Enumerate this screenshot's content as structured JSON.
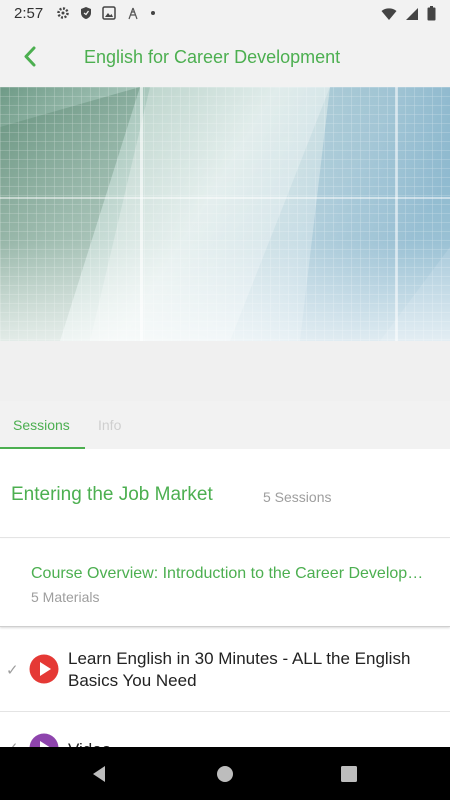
{
  "status_bar": {
    "time": "2:57",
    "icons": [
      "gear-icon",
      "shield-icon",
      "image-icon",
      "tower-icon",
      "dot-icon",
      "wifi-icon",
      "cell-signal-icon",
      "battery-icon"
    ]
  },
  "app_bar": {
    "back_icon": "chevron-left-icon",
    "title": "English for Career Development"
  },
  "tabs": [
    {
      "label": "Sessions",
      "active": true
    },
    {
      "label": "Info",
      "active": false
    }
  ],
  "section": {
    "title": "Entering the Job Market",
    "count": "5 Sessions"
  },
  "subsection": {
    "title": "Course Overview: Introduction to the Career Development Program",
    "count": "5 Materials"
  },
  "items": [
    {
      "title": "Learn English in 30 Minutes - ALL the English Basics You Need",
      "icon": "play-icon",
      "icon_color": "#e53935",
      "completed": true
    },
    {
      "title": "Video",
      "icon": "play-icon",
      "icon_color": "#8e44ad",
      "completed": true
    }
  ],
  "nav_bar": [
    "back-triangle-icon",
    "home-circle-icon",
    "recents-square-icon"
  ],
  "colors": {
    "accent": "#4caf50",
    "background": "#f2f2f2"
  }
}
